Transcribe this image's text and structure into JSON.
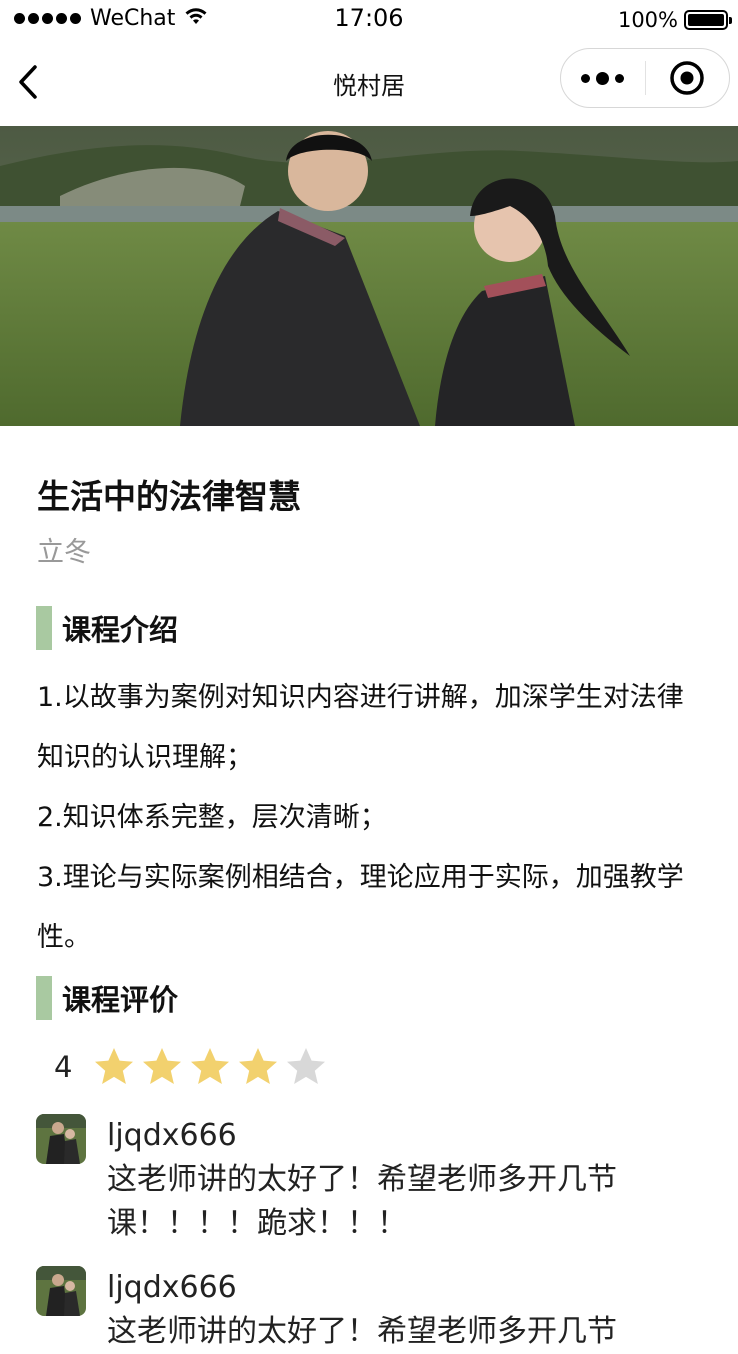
{
  "status_bar": {
    "carrier": "WeChat",
    "time": "17:06",
    "battery": "100%"
  },
  "nav": {
    "title": "悦村居"
  },
  "course": {
    "title": "生活中的法律智慧",
    "teacher": "立冬"
  },
  "intro": {
    "heading": "课程介绍",
    "lines": [
      "1.以故事为案例对知识内容进行讲解，加深学生对法律知识的认识理解；",
      "2.知识体系完整，层次清晰；",
      "3.理论与实际案例相结合，理论应用于实际，加强教学性。"
    ]
  },
  "evaluation": {
    "heading": "课程评价",
    "rating": "4",
    "rating_value": 4,
    "rating_max": 5,
    "star_color": "#f2d16e",
    "star_empty_color": "#d8d8d8"
  },
  "reviews": [
    {
      "user": "ljqdx666",
      "content": "这老师讲的太好了！希望老师多开几节课！！！！跪求！！！"
    },
    {
      "user": "ljqdx666",
      "content": "这老师讲的太好了！希望老师多开几节"
    }
  ],
  "colors": {
    "accent_bar": "#a9c9a1",
    "muted_text": "#999999"
  }
}
